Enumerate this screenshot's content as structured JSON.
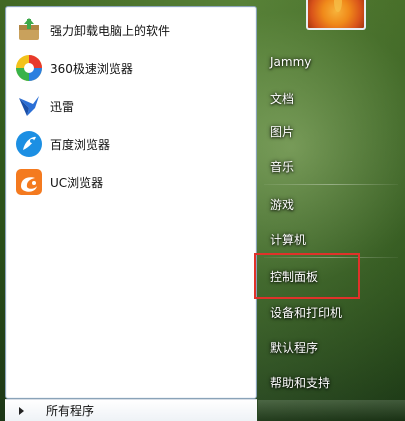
{
  "programs": [
    {
      "label": "强力卸载电脑上的软件",
      "icon": "uninstall-box-icon"
    },
    {
      "label": "360极速浏览器",
      "icon": "360-browser-icon"
    },
    {
      "label": "迅雷",
      "icon": "xunlei-bird-icon"
    },
    {
      "label": "百度浏览器",
      "icon": "baidu-browser-icon"
    },
    {
      "label": "UC浏览器",
      "icon": "uc-browser-icon"
    }
  ],
  "all_programs_label": "所有程序",
  "right_menu": {
    "user": "Jammy",
    "items": [
      "文档",
      "图片",
      "音乐",
      "游戏",
      "计算机",
      "控制面板",
      "设备和打印机",
      "默认程序",
      "帮助和支持"
    ]
  },
  "highlighted_item": "控制面板",
  "colors": {
    "highlight": "#e0322a"
  }
}
